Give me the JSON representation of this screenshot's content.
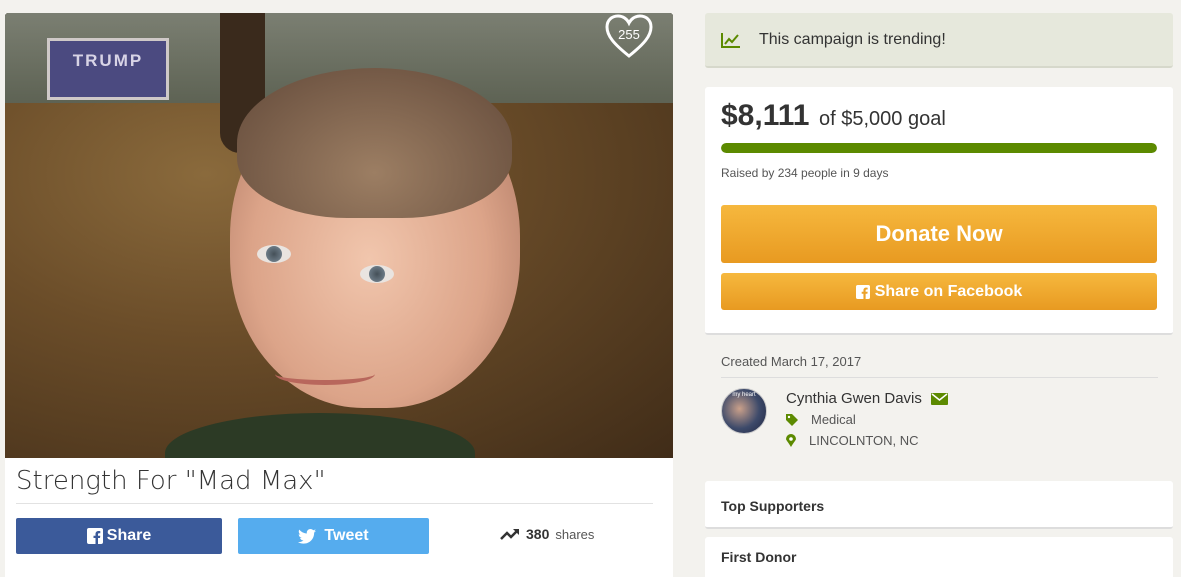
{
  "campaign": {
    "title": "Strength For \"Mad Max\"",
    "heart_count": "255",
    "photo_sign_text": "TRUMP"
  },
  "social": {
    "share_label": "Share",
    "tweet_label": "Tweet",
    "shares_count": "380",
    "shares_label": "shares"
  },
  "trending": {
    "text": "This campaign is trending!"
  },
  "funding": {
    "raised": "$8,111",
    "goal_text": "of $5,000 goal",
    "progress_fraction": 1.0,
    "raised_by": "Raised by 234 people in 9 days",
    "donate_label": "Donate Now",
    "facebook_label": "Share on Facebook"
  },
  "organizer": {
    "created": "Created March 17, 2017",
    "name": "Cynthia Gwen Davis",
    "avatar_text": "my heart",
    "category": "Medical",
    "location": "LINCOLNTON, NC"
  },
  "sections": {
    "top_supporters": "Top Supporters",
    "first_donor": "First Donor"
  },
  "colors": {
    "accent_green": "#5c8a00",
    "donate_orange": "#f0a52e",
    "facebook_blue": "#3b5a9a",
    "twitter_blue": "#55acee"
  }
}
